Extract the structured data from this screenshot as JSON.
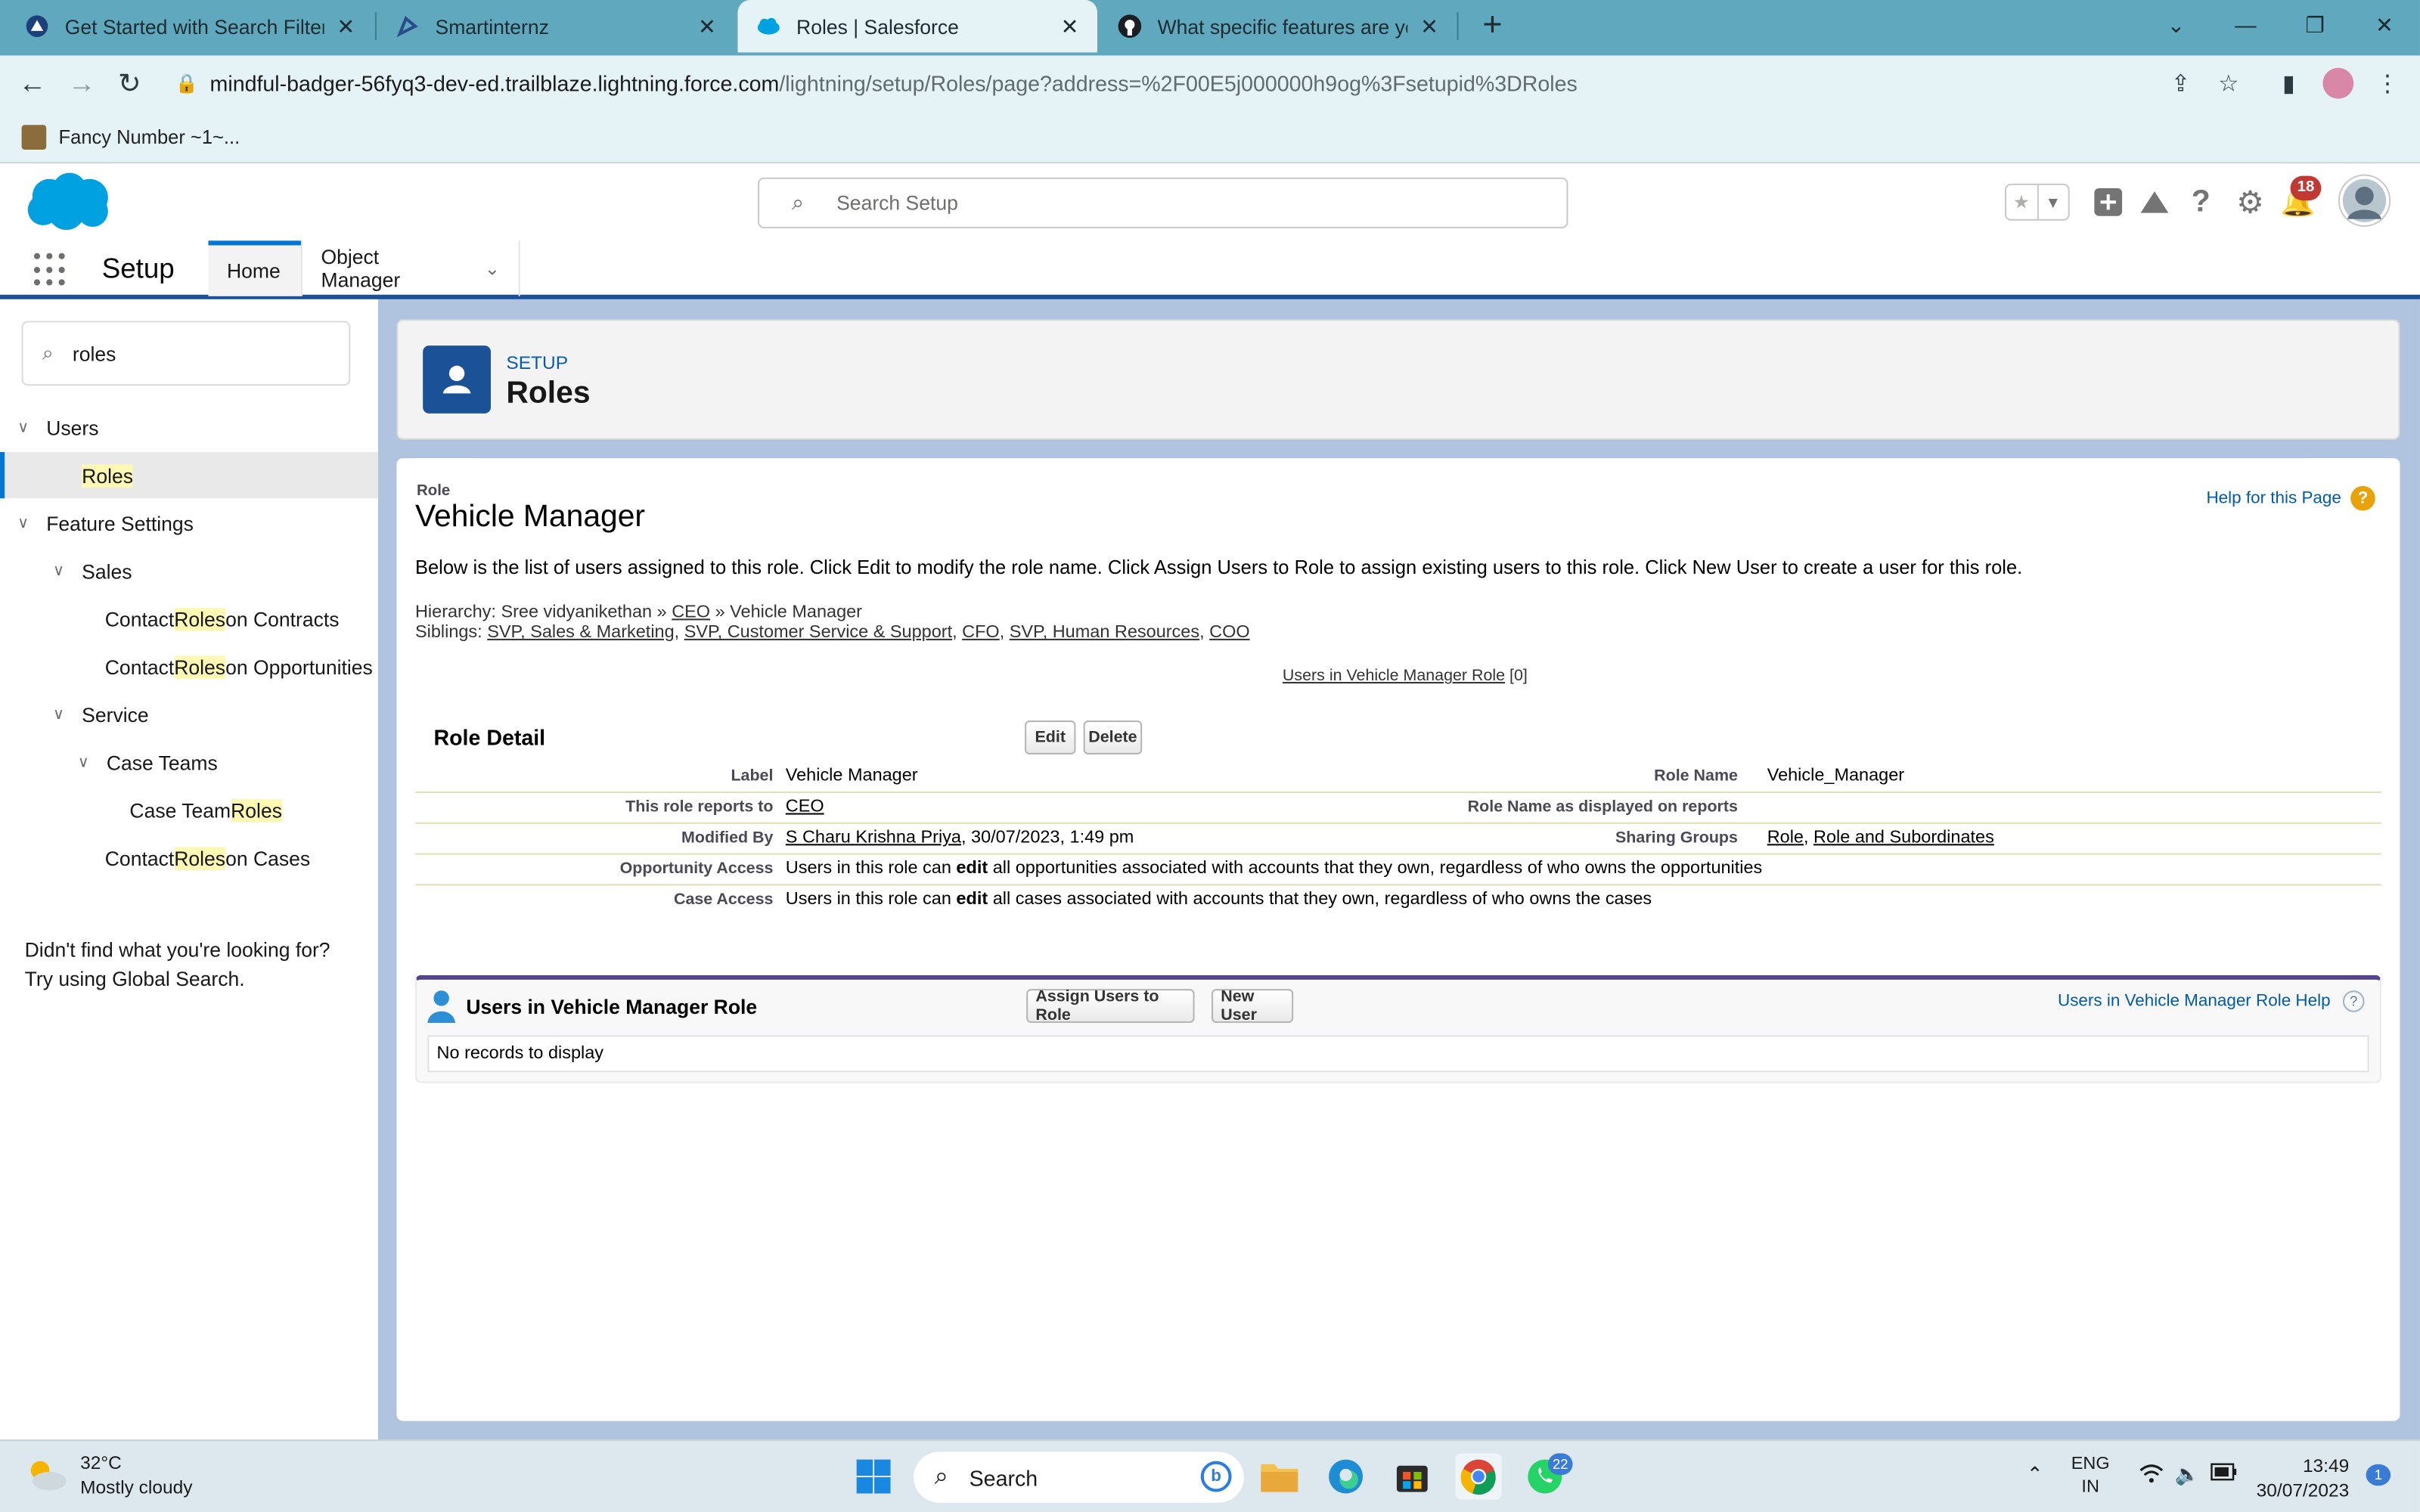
{
  "browser": {
    "tabs": [
      {
        "title": "Get Started with Search Filters in",
        "active": false
      },
      {
        "title": "Smartinternz",
        "active": false
      },
      {
        "title": "Roles | Salesforce",
        "active": true
      },
      {
        "title": "What specific features are you int",
        "active": false
      }
    ],
    "url_host": "mindful-badger-56fyq3-dev-ed.trailblaze.lightning.force.com",
    "url_path": "/lightning/setup/Roles/page?address=%2F00E5j000000h9og%3Fsetupid%3DRoles",
    "bookmark": "Fancy Number ~1~..."
  },
  "header": {
    "search_placeholder": "Search Setup",
    "notification_count": "18",
    "brand_color": "#00a1e0"
  },
  "nav": {
    "app_name": "Setup",
    "tabs": [
      "Home",
      "Object Manager"
    ]
  },
  "sidebar": {
    "quickfind_value": "roles",
    "tree": [
      {
        "pre": "Users",
        "hl": "",
        "post": ""
      },
      {
        "pre": "",
        "hl": "Roles",
        "post": ""
      },
      {
        "pre": "Feature Settings",
        "hl": "",
        "post": ""
      },
      {
        "pre": "Sales",
        "hl": "",
        "post": ""
      },
      {
        "pre": "Contact ",
        "hl": "Roles",
        "post": " on Contracts"
      },
      {
        "pre": "Contact ",
        "hl": "Roles",
        "post": " on Opportunities"
      },
      {
        "pre": "Service",
        "hl": "",
        "post": ""
      },
      {
        "pre": "Case Teams",
        "hl": "",
        "post": ""
      },
      {
        "pre": "Case Team ",
        "hl": "Roles",
        "post": ""
      },
      {
        "pre": "Contact ",
        "hl": "Roles",
        "post": " on Cases"
      }
    ],
    "help_line1": "Didn't find what you're looking for?",
    "help_line2": "Try using Global Search."
  },
  "page_header": {
    "kicker": "SETUP",
    "title": "Roles"
  },
  "role": {
    "kicker": "Role",
    "name": "Vehicle Manager",
    "help_link": "Help for this Page",
    "description": "Below is the list of users assigned to this role. Click Edit to modify the role name. Click Assign Users to Role to assign existing users to this role. Click New User to create a user for this role.",
    "hierarchy_label": "Hierarchy: ",
    "hierarchy_root": "Sree vidyanikethan",
    "hierarchy_sep": " » ",
    "hierarchy_parent": "CEO",
    "hierarchy_current": "Vehicle Manager",
    "siblings_label": "Siblings: ",
    "siblings": [
      "SVP, Sales & Marketing",
      "SVP, Customer Service & Support",
      "CFO",
      "SVP, Human Resources",
      "COO"
    ],
    "related_link": "Users in Vehicle Manager Role",
    "related_count": "[0]"
  },
  "detail": {
    "title": "Role Detail",
    "edit_label": "Edit",
    "delete_label": "Delete",
    "label_label": "Label",
    "label_value": "Vehicle Manager",
    "role_name_label": "Role Name",
    "role_name_value": "Vehicle_Manager",
    "reports_to_label": "This role reports to",
    "reports_to_value": "CEO",
    "display_name_label": "Role Name as displayed on reports",
    "modified_by_label": "Modified By",
    "modified_by_user": "S Charu Krishna Priya",
    "modified_by_date": ", 30/07/2023, 1:49 pm",
    "sharing_groups_label": "Sharing Groups",
    "sharing_group_1": "Role",
    "sharing_group_sep": ", ",
    "sharing_group_2": "Role and Subordinates",
    "opp_access_label": "Opportunity Access",
    "opp_access_pre": "Users in this role can ",
    "opp_access_bold": "edit",
    "opp_access_post": " all opportunities associated with accounts that they own, regardless of who owns the opportunities",
    "case_access_label": "Case Access",
    "case_access_pre": "Users in this role can ",
    "case_access_bold": "edit",
    "case_access_post": " all cases associated with accounts that they own, regardless of who owns the cases"
  },
  "users_list": {
    "title": "Users in Vehicle Manager Role",
    "assign_label": "Assign Users to Role",
    "new_user_label": "New User",
    "help_link": "Users in Vehicle Manager Role Help",
    "empty_text": "No records to display"
  },
  "taskbar": {
    "temperature": "32°C",
    "weather": "Mostly cloudy",
    "search_label": "Search",
    "lang_1": "ENG",
    "lang_2": "IN",
    "time": "13:49",
    "date": "30/07/2023",
    "whatsapp_badge": "22",
    "notif_count": "1"
  }
}
